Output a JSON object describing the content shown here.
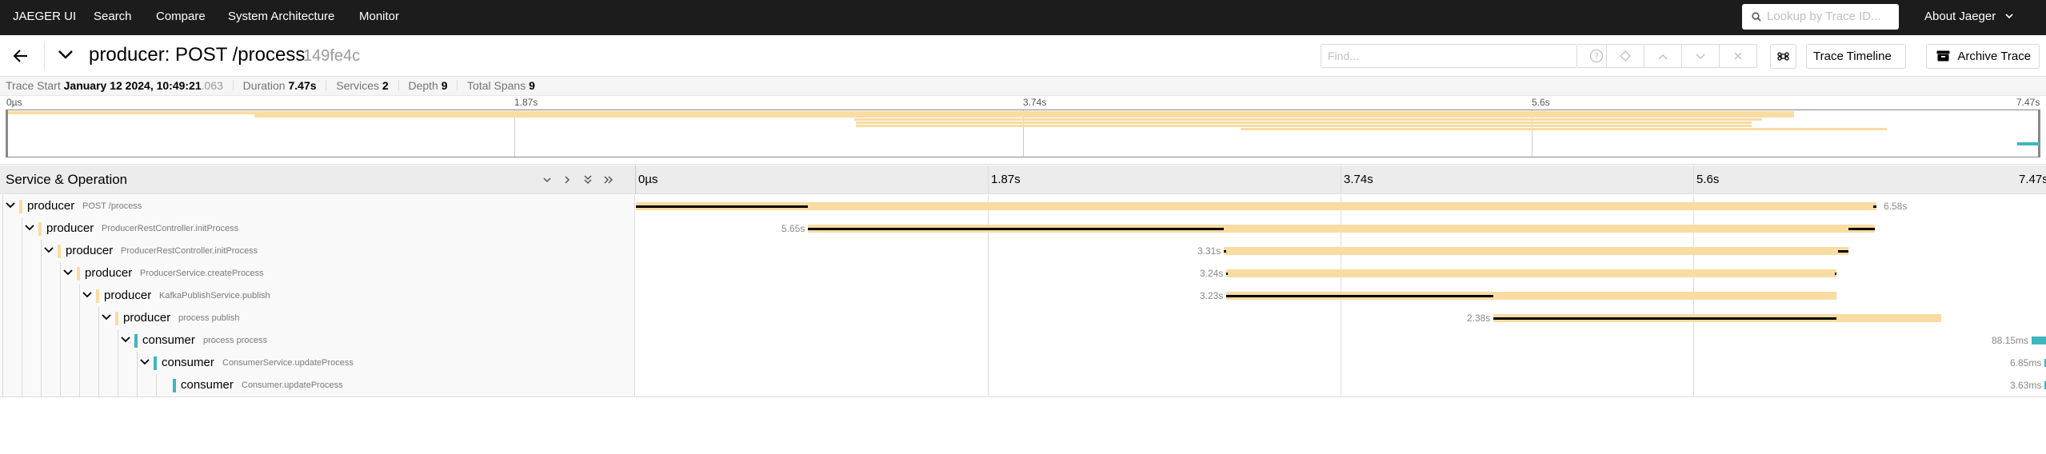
{
  "nav": {
    "brand": "JAEGER UI",
    "items": [
      "Search",
      "Compare",
      "System Architecture",
      "Monitor"
    ],
    "lookup_placeholder": "Lookup by Trace ID...",
    "about": "About Jaeger"
  },
  "header": {
    "title": "producer: POST /process",
    "trace_id": "149fe4c",
    "find_placeholder": "Find...",
    "view_select": "Trace Timeline",
    "archive_label": "Archive Trace"
  },
  "summary": {
    "trace_start_label": "Trace Start",
    "trace_start_value": "January 12 2024, 10:49:21",
    "trace_start_ms": ".063",
    "duration_label": "Duration",
    "duration_value": "7.47s",
    "services_label": "Services",
    "services_value": "2",
    "depth_label": "Depth",
    "depth_value": "9",
    "total_spans_label": "Total Spans",
    "total_spans_value": "9"
  },
  "minimap": {
    "ticks": [
      "0µs",
      "1.87s",
      "3.74s",
      "5.6s",
      "7.47s"
    ]
  },
  "timeline": {
    "column_title": "Service & Operation",
    "ticks": [
      "0µs",
      "1.87s",
      "3.74s",
      "5.6s",
      "7.47s"
    ]
  },
  "colors": {
    "producer": "#f8dca1",
    "consumer": "#3fb6bf",
    "critical": "#000000"
  },
  "spans": [
    {
      "service": "producer",
      "operation": "POST /process",
      "duration": "6.58s"
    },
    {
      "service": "producer",
      "operation": "ProducerRestController.initProcess",
      "duration": "5.65s"
    },
    {
      "service": "producer",
      "operation": "ProducerRestController.initProcess",
      "duration": "3.31s"
    },
    {
      "service": "producer",
      "operation": "ProducerService.createProcess",
      "duration": "3.24s"
    },
    {
      "service": "producer",
      "operation": "KafkaPublishService.publish",
      "duration": "3.23s"
    },
    {
      "service": "producer",
      "operation": "process publish",
      "duration": "2.38s"
    },
    {
      "service": "consumer",
      "operation": "process process",
      "duration": "88.15ms"
    },
    {
      "service": "consumer",
      "operation": "ConsumerService.updateProcess",
      "duration": "6.85ms"
    },
    {
      "service": "consumer",
      "operation": "Consumer.updateProcess",
      "duration": "3.63ms"
    }
  ]
}
